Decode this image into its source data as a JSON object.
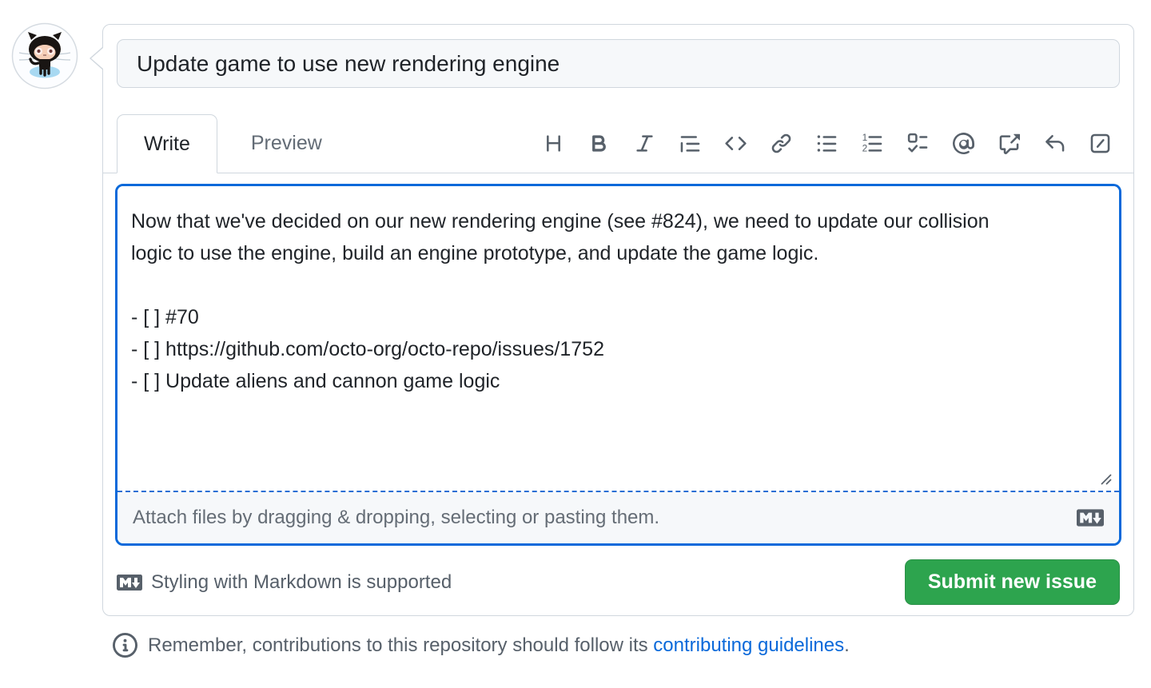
{
  "avatar": {
    "name": "octocat"
  },
  "title_field": {
    "value": "Update game to use new rendering engine"
  },
  "tabs": {
    "write": "Write",
    "preview": "Preview"
  },
  "toolbar": {
    "icons": [
      "heading",
      "bold",
      "italic",
      "quote",
      "code",
      "link",
      "unordered-list",
      "ordered-list",
      "tasklist",
      "mention",
      "cross-reference",
      "reply",
      "slash-commands"
    ]
  },
  "editor": {
    "body": "Now that we've decided on our new rendering engine (see #824), we need to update our collision\nlogic to use the engine, build an engine prototype, and update the game logic.\n\n- [ ] #70\n- [ ] https://github.com/octo-org/octo-repo/issues/1752\n- [ ] Update aliens and cannon game logic",
    "attach_hint": "Attach files by dragging & dropping, selecting or pasting them."
  },
  "actions": {
    "markdown_note": "Styling with Markdown is supported",
    "submit": "Submit new issue"
  },
  "footnote": {
    "prefix": "Remember, contributions to this repository should follow its ",
    "link": "contributing guidelines",
    "suffix": "."
  },
  "colors": {
    "focus_blue": "#0969da",
    "submit_green": "#2da44e",
    "border_gray": "#d0d7de",
    "muted_text": "#656d76",
    "body_text": "#1f2328",
    "field_bg": "#f6f8fa"
  }
}
